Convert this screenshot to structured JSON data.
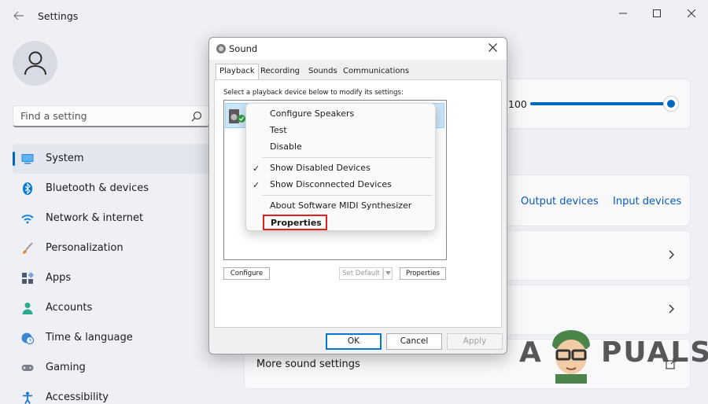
{
  "window": {
    "back_icon": "back-arrow-icon",
    "title": "Settings",
    "controls": [
      "minimize",
      "maximize",
      "close"
    ]
  },
  "search": {
    "placeholder": "Find a setting",
    "icon": "search-icon"
  },
  "nav": {
    "items": [
      {
        "label": "System",
        "icon": "monitor-icon",
        "color": "#0067c0",
        "active": true
      },
      {
        "label": "Bluetooth & devices",
        "icon": "bluetooth-icon",
        "color": "#0078d4"
      },
      {
        "label": "Network & internet",
        "icon": "wifi-icon",
        "color": "#1a86d9"
      },
      {
        "label": "Personalization",
        "icon": "brush-icon",
        "color": "#e3862a"
      },
      {
        "label": "Apps",
        "icon": "apps-icon",
        "color": "#4d5a6e"
      },
      {
        "label": "Accounts",
        "icon": "person-icon",
        "color": "#2fa892"
      },
      {
        "label": "Time & language",
        "icon": "clock-globe-icon",
        "color": "#3a86d1"
      },
      {
        "label": "Gaming",
        "icon": "gamepad-icon",
        "color": "#7a7f8a"
      },
      {
        "label": "Accessibility",
        "icon": "accessibility-icon",
        "color": "#1f7ad1"
      }
    ]
  },
  "content": {
    "volume_value": "100",
    "volume_level": 1.0,
    "output_devices_link": "Output devices",
    "input_devices_link": "Input devices",
    "more_sound_settings": "More sound settings"
  },
  "sound_dialog": {
    "title": "Sound",
    "tabs": [
      "Playback",
      "Recording",
      "Sounds",
      "Communications"
    ],
    "active_tab": "Playback",
    "instruction": "Select a playback device below to modify its settings:",
    "configure_button": "Configure",
    "set_default_button": "Set Default",
    "properties_button": "Properties",
    "ok_button": "OK",
    "cancel_button": "Cancel",
    "apply_button": "Apply"
  },
  "context_menu": {
    "items": [
      {
        "label": "Configure Speakers",
        "checked": false
      },
      {
        "label": "Test",
        "checked": false
      },
      {
        "label": "Disable",
        "checked": false
      },
      {
        "label": "Show Disabled Devices",
        "checked": true
      },
      {
        "label": "Show Disconnected Devices",
        "checked": true
      },
      {
        "label": "About Software MIDI Synthesizer",
        "checked": false
      },
      {
        "label": "Properties",
        "checked": false,
        "highlighted": true
      }
    ],
    "check_glyph": "✓",
    "highlight_color": "#e02020"
  },
  "watermark": {
    "letter_a": "A",
    "rest": "PUALS"
  }
}
